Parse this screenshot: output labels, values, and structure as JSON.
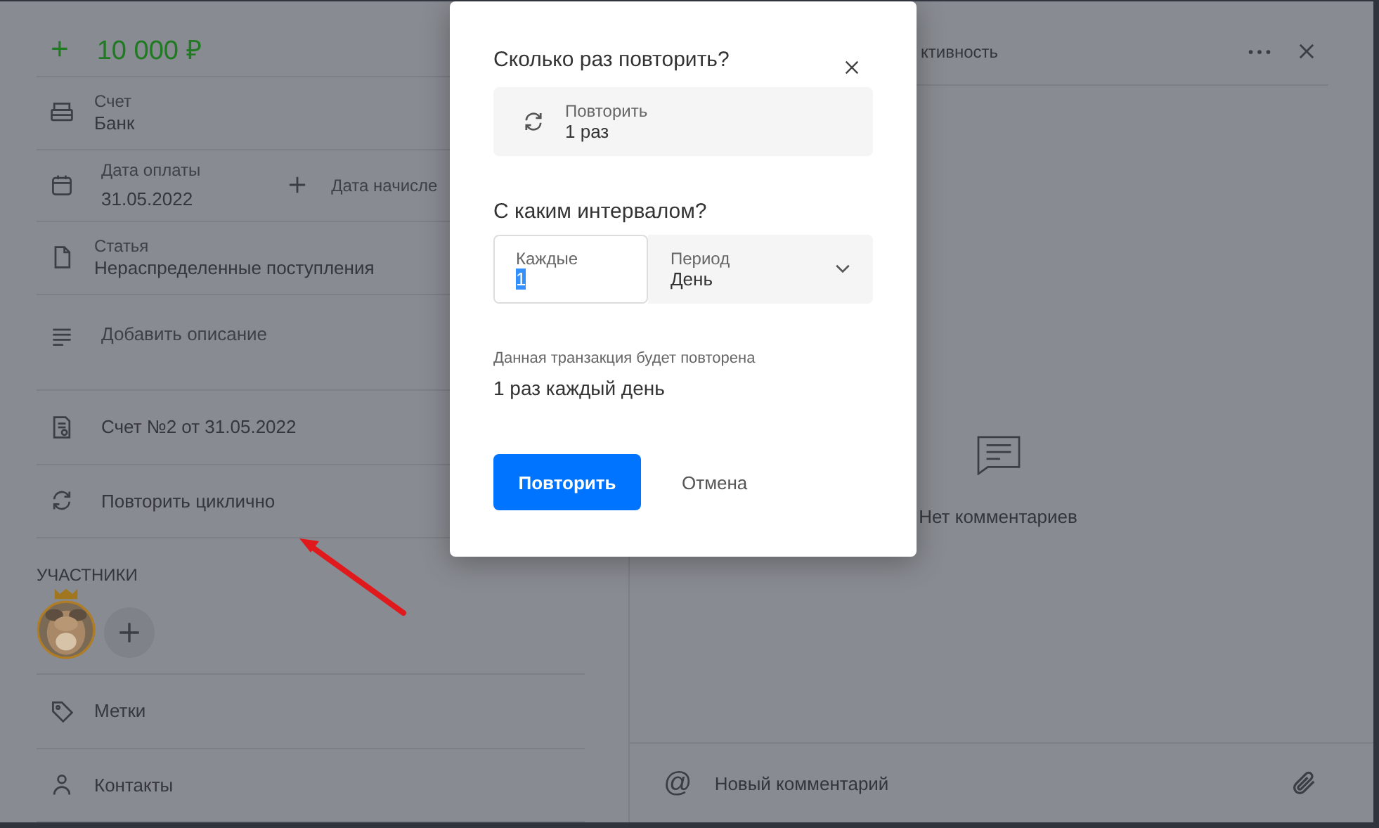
{
  "amount": {
    "sign": "+",
    "value": "10 000 ₽"
  },
  "fields": [
    {
      "kind": "bank",
      "label": "Счет",
      "value": "Банк"
    },
    {
      "kind": "date",
      "label": "Дата оплаты",
      "value": "31.05.2022",
      "extra": "Дата начисле"
    },
    {
      "kind": "document",
      "label": "Статья",
      "value": "Нераспределенные поступления"
    },
    {
      "kind": "description",
      "value": "Добавить описание"
    },
    {
      "kind": "invoice",
      "value": "Счет №2 от 31.05.2022"
    },
    {
      "kind": "repeat",
      "value": "Повторить циклично"
    }
  ],
  "participants": {
    "title": "УЧАСТНИКИ",
    "owner_crown": true
  },
  "bottom_fields": [
    {
      "kind": "tag",
      "value": "Метки"
    },
    {
      "kind": "contact",
      "value": "Контакты"
    }
  ],
  "activity": {
    "title": "ктивность",
    "empty_text": "Нет комментариев",
    "comment_placeholder": "Новый комментарий",
    "at_sign": "@"
  },
  "dialog": {
    "title": "Сколько раз повторить?",
    "repeat": {
      "label": "Повторить",
      "value": "1 раз"
    },
    "interval_title": "С каким интервалом?",
    "every": {
      "label": "Каждые",
      "value": "1",
      "value_selected": true
    },
    "period": {
      "label": "Период",
      "value": "День"
    },
    "summary_label": "Данная транзакция будет повторена",
    "summary": "1 раз каждый день",
    "confirm": "Повторить",
    "cancel": "Отмена"
  }
}
